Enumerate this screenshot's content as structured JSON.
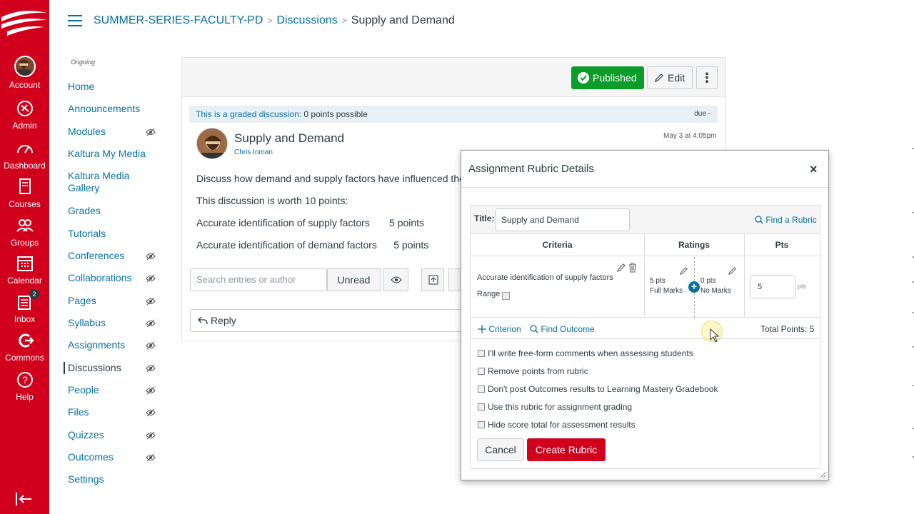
{
  "global_nav": {
    "items": [
      {
        "label": "Account",
        "icon": "user-avatar"
      },
      {
        "label": "Admin",
        "icon": "shield-icon"
      },
      {
        "label": "Dashboard",
        "icon": "dashboard-icon"
      },
      {
        "label": "Courses",
        "icon": "book-icon"
      },
      {
        "label": "Groups",
        "icon": "groups-icon"
      },
      {
        "label": "Calendar",
        "icon": "calendar-icon"
      },
      {
        "label": "Inbox",
        "icon": "inbox-icon",
        "badge": "2"
      },
      {
        "label": "Commons",
        "icon": "commons-icon"
      },
      {
        "label": "Help",
        "icon": "help-icon"
      }
    ],
    "color": "#d1001c"
  },
  "breadcrumb": {
    "course": "SUMMER-SERIES-FACULTY-PD",
    "section": "Discussions",
    "current": "Supply and Demand"
  },
  "course_nav": {
    "term": "Ongoing",
    "items": [
      {
        "label": "Home",
        "hidden": false
      },
      {
        "label": "Announcements",
        "hidden": false
      },
      {
        "label": "Modules",
        "hidden": true
      },
      {
        "label": "Kaltura My Media",
        "hidden": false
      },
      {
        "label": "Kaltura Media Gallery",
        "hidden": false
      },
      {
        "label": "Grades",
        "hidden": false
      },
      {
        "label": "Tutorials",
        "hidden": false
      },
      {
        "label": "Conferences",
        "hidden": true
      },
      {
        "label": "Collaborations",
        "hidden": true
      },
      {
        "label": "Pages",
        "hidden": true
      },
      {
        "label": "Syllabus",
        "hidden": true
      },
      {
        "label": "Assignments",
        "hidden": true
      },
      {
        "label": "Discussions",
        "hidden": true,
        "active": true
      },
      {
        "label": "People",
        "hidden": true
      },
      {
        "label": "Files",
        "hidden": true
      },
      {
        "label": "Quizzes",
        "hidden": true
      },
      {
        "label": "Outcomes",
        "hidden": true
      },
      {
        "label": "Settings",
        "hidden": false
      }
    ]
  },
  "discussion": {
    "published_label": "Published",
    "edit_label": "Edit",
    "graded_prefix": "This is a graded discussion:",
    "graded_points": " 0 points possible",
    "due": "due -",
    "title": "Supply and Demand",
    "author": "Chris Inman",
    "date": "May 3 at 4:05pm",
    "body": [
      "Discuss how demand and supply factors have influenced the cu",
      "This discussion is worth 10 points:",
      "Accurate identification of supply factors       5 points",
      "Accurate identification of demand factors      5 points"
    ],
    "search_placeholder": "Search entries or author",
    "unread_label": "Unread",
    "reply_label": "Reply"
  },
  "rubric_dialog": {
    "title": "Assignment Rubric Details",
    "close": "×",
    "title_label": "Title:",
    "title_value": "Supply and Demand",
    "find_rubric": "Find a Rubric",
    "headers": {
      "criteria": "Criteria",
      "ratings": "Ratings",
      "pts": "Pts"
    },
    "criterion": {
      "description": "Accurate identification of supply factors",
      "range_label": "Range",
      "ratings": [
        {
          "points": "5 pts",
          "label": "Full Marks"
        },
        {
          "points": "0 pts",
          "label": "No Marks"
        }
      ],
      "points_value": "5",
      "points_suffix": "pts"
    },
    "add_criterion": "Criterion",
    "find_outcome": "Find Outcome",
    "total_points": "Total Points: 5",
    "options": [
      "I'll write free-form comments when assessing students",
      "Remove points from rubric",
      "Don't post Outcomes results to Learning Mastery Gradebook",
      "Use this rubric for assignment grading",
      "Hide score total for assessment results"
    ],
    "cancel_label": "Cancel",
    "create_label": "Create Rubric"
  }
}
